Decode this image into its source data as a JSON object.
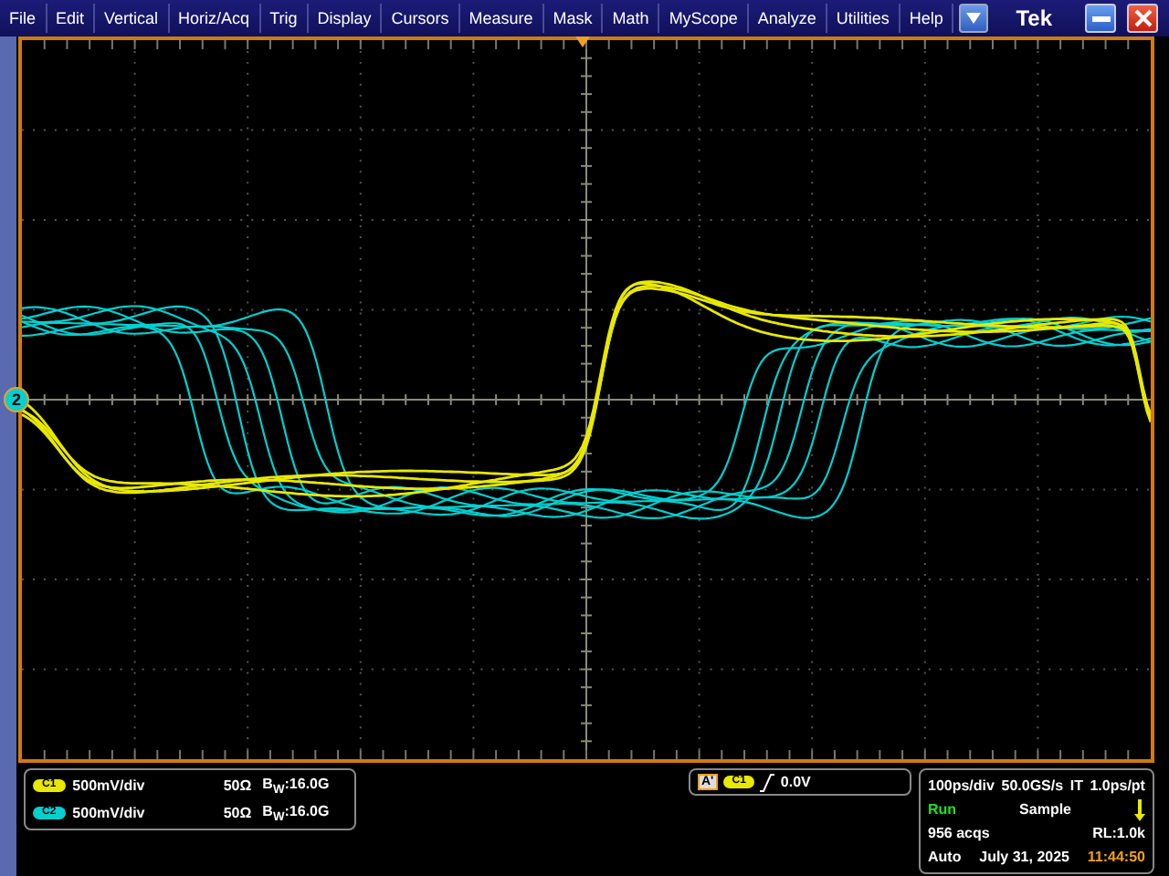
{
  "menu": [
    "File",
    "Edit",
    "Vertical",
    "Horiz/Acq",
    "Trig",
    "Display",
    "Cursors",
    "Measure",
    "Mask",
    "Math",
    "MyScope",
    "Analyze",
    "Utilities",
    "Help"
  ],
  "brand": "Tek",
  "ground_marker": {
    "label": "2",
    "color": "#00d0d0"
  },
  "channels": [
    {
      "badge": "C1",
      "color": "#e8e800",
      "scale": "500mV/div",
      "impedance": "50Ω",
      "bandwidth": "B$_{W}$:16.0G"
    },
    {
      "badge": "C2",
      "color": "#00d0d0",
      "scale": "500mV/div",
      "impedance": "50Ω",
      "bandwidth": "B$_{W}$:16.0G"
    }
  ],
  "trigger": {
    "tag": "A'",
    "badge": "C1",
    "color": "#e8e800",
    "level": "0.0V"
  },
  "acquisition": {
    "horizontal": "100ps/div",
    "rate": "50.0GS/s",
    "interp": "IT",
    "resolution": "1.0ps/pt",
    "state": "Run",
    "mode": "Sample",
    "count": "956 acqs",
    "record_length": "RL:1.0k",
    "trigger_mode": "Auto",
    "date": "July 31, 2025",
    "time": "11:44:50"
  }
}
